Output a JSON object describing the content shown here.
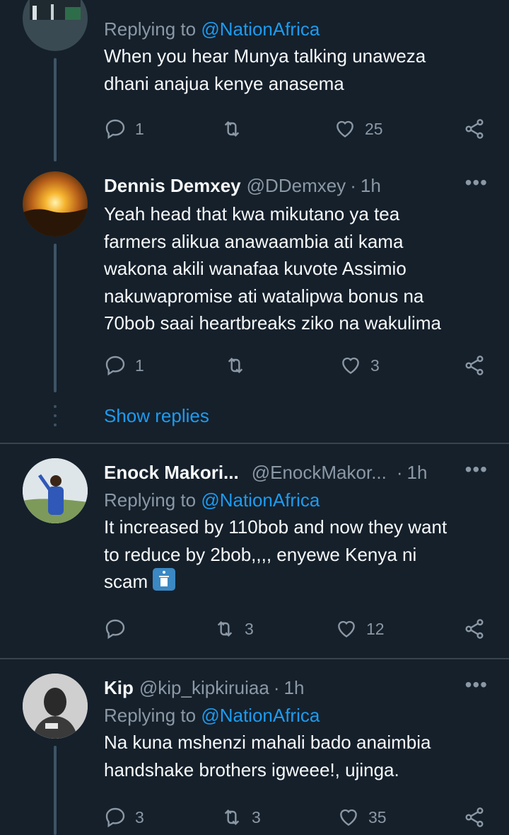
{
  "tweets": [
    {
      "replying_prefix": "Replying to",
      "replying_mention": "@NationAfrica",
      "lines": [
        "When you hear Munya talking unaweza",
        "dhani anajua kenye anasema"
      ],
      "replies": "1",
      "retweets": "",
      "likes": "25"
    },
    {
      "name": "Dennis Demxey",
      "handle": "@DDemxey",
      "time": "1h",
      "lines": [
        "Yeah head that kwa mikutano ya tea",
        "farmers alikua anawaambia ati kama",
        "wakona akili wanafaa kuvote Assimio",
        "nakuwapromise  ati watalipwa bonus na",
        "70bob saai heartbreaks ziko na wakulima"
      ],
      "replies": "1",
      "retweets": "",
      "likes": "3"
    },
    {
      "name": "Enock Makori...",
      "handle": "@EnockMakor...",
      "time": "1h",
      "replying_prefix": "Replying to",
      "replying_mention": "@NationAfrica",
      "lines": [
        "It increased by 110bob and now they want",
        "to reduce by 2bob,,,, enyewe Kenya ni",
        "scam"
      ],
      "replies": "",
      "retweets": "3",
      "likes": "12"
    },
    {
      "name": "Kip",
      "handle": "@kip_kipkiruiaa",
      "time": "1h",
      "replying_prefix": "Replying to",
      "replying_mention": "@NationAfrica",
      "lines": [
        "Na kuna mshenzi mahali bado anaimbia",
        "handshake brothers igweee!, ujinga."
      ],
      "replies": "3",
      "retweets": "3",
      "likes": "35"
    }
  ],
  "show_replies": "Show replies",
  "dot": "·",
  "more": "•••",
  "colors": {
    "background": "#15202b",
    "accent": "#1d9bf0",
    "muted": "#8b98a5"
  }
}
